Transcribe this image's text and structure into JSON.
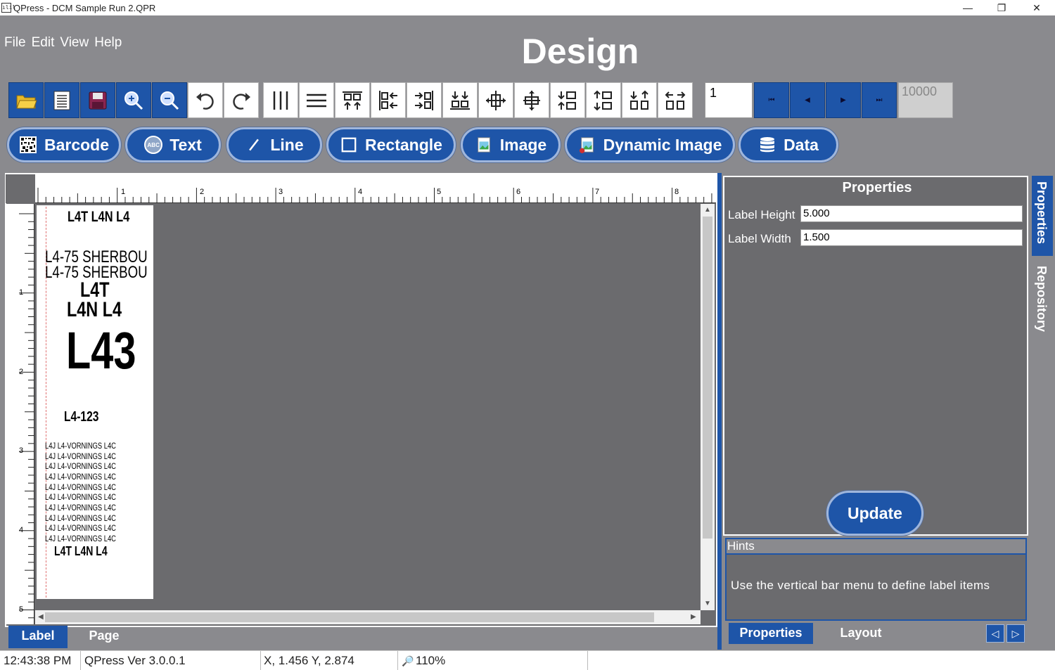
{
  "window": {
    "icon_glyph": "ılıl",
    "title": "QPress - DCM Sample Run 2.QPR",
    "min_glyph": "—",
    "max_glyph": "❐",
    "close_glyph": "✕"
  },
  "menu": {
    "items": [
      {
        "label": "File"
      },
      {
        "label": "Edit"
      },
      {
        "label": "View"
      },
      {
        "label": "Help"
      }
    ]
  },
  "header": {
    "title": "Design"
  },
  "toolbar": {
    "buttons": [
      {
        "name": "open-icon"
      },
      {
        "name": "new-icon"
      },
      {
        "name": "save-icon"
      },
      {
        "name": "zoom-in-icon"
      },
      {
        "name": "zoom-out-icon"
      },
      {
        "name": "undo-icon"
      },
      {
        "name": "redo-icon"
      },
      {
        "name": "vertical-lines-icon"
      },
      {
        "name": "horizontal-lines-icon"
      },
      {
        "name": "align-top-icon"
      },
      {
        "name": "align-left-icon"
      },
      {
        "name": "align-right-icon"
      },
      {
        "name": "align-bottom-icon"
      },
      {
        "name": "center-horizontal-icon"
      },
      {
        "name": "center-vertical-icon"
      },
      {
        "name": "space-vertical-icon"
      },
      {
        "name": "space-vertical-alt-icon"
      },
      {
        "name": "space-horizontal-icon"
      },
      {
        "name": "space-horizontal-alt-icon"
      }
    ],
    "page_value": "1",
    "nav": {
      "first": "⏮",
      "prev": "◀",
      "next": "▶",
      "last": "⏭"
    },
    "max_value": "10000"
  },
  "tools": [
    {
      "label": "Barcode",
      "icon": "barcode-icon"
    },
    {
      "label": "Text",
      "icon": "text-abc-icon",
      "icon_text": "ABC"
    },
    {
      "label": "Line",
      "icon": "line-icon"
    },
    {
      "label": "Rectangle",
      "icon": "rectangle-icon"
    },
    {
      "label": "Image",
      "icon": "image-icon"
    },
    {
      "label": "Dynamic Image",
      "icon": "dynamic-image-icon"
    },
    {
      "label": "Data",
      "icon": "database-icon"
    }
  ],
  "ruler": {
    "top_marks": [
      "1",
      "2",
      "3",
      "4",
      "5",
      "6",
      "7",
      "8"
    ],
    "left_marks": [
      "1",
      "2",
      "3",
      "4",
      "5"
    ]
  },
  "label": {
    "line1": "L4T L4N L4",
    "line2": "L4-75 SHERBOU",
    "line3": "L4-75 SHERBOU",
    "line4": "L4T",
    "line5": "L4N L4",
    "line6": "L43",
    "line7": "L4-123",
    "repeat_line": "L4J L4-VORNINGS L4C",
    "line_last": "L4T L4N L4"
  },
  "canvas_tabs": {
    "label": "Label",
    "page": "Page"
  },
  "properties": {
    "title": "Properties",
    "label_height_label": "Label Height",
    "label_height_value": "5.000",
    "label_width_label": "Label Width",
    "label_width_value": "1.500",
    "update": "Update"
  },
  "hints": {
    "title": "Hints",
    "text": "Use the vertical bar menu to define label items"
  },
  "panel_tabs": {
    "properties": "Properties",
    "layout": "Layout",
    "prev": "◁",
    "next": "▷"
  },
  "side_tabs": {
    "properties": "Properties",
    "repository": "Repository"
  },
  "status": {
    "time": "12:43:38 PM",
    "version": "QPress Ver 3.0.0.1",
    "coords": "X, 1.456 Y, 2.874",
    "zoom_glyph": "🔎",
    "zoom": "110%"
  },
  "colors": {
    "accent": "#1e55a8",
    "background": "#8a8a8e",
    "workspace": "#6b6b6e"
  }
}
